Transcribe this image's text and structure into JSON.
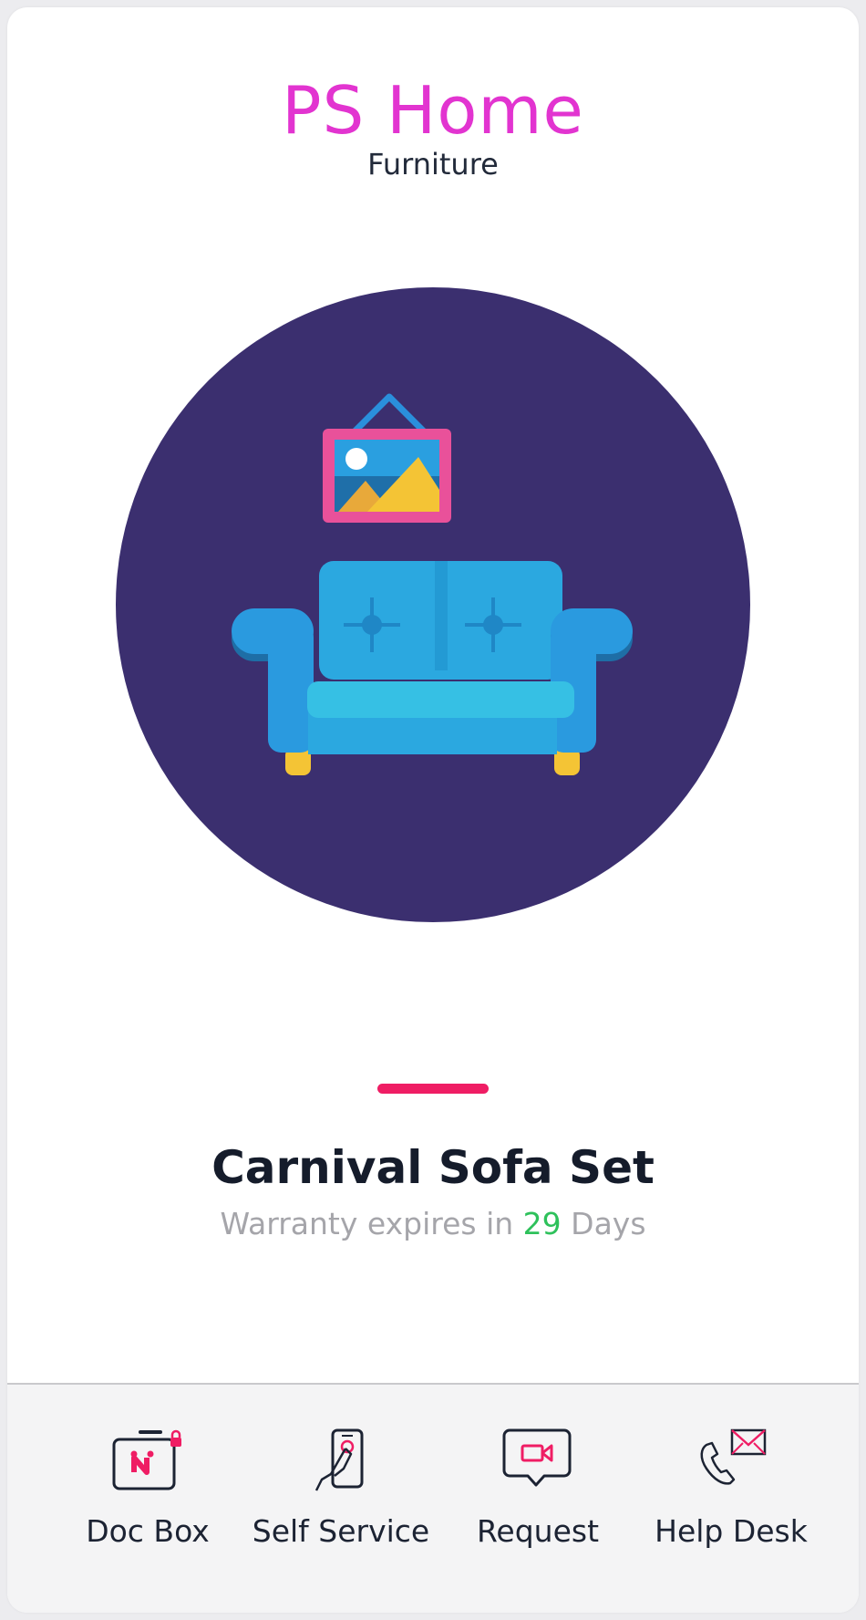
{
  "brand": {
    "title": "PS Home",
    "subtitle": "Furniture"
  },
  "hero": {
    "illustration": "sofa-with-picture-frame",
    "background_color": "#3b2f6f"
  },
  "product": {
    "name": "Carnival Sofa Set",
    "warranty_prefix": "Warranty expires in",
    "warranty_days": "29",
    "warranty_suffix": "Days"
  },
  "colors": {
    "brand": "#e234d0",
    "accent": "#ef1d64",
    "days_highlight": "#2ec15b",
    "muted_text": "#a5a5aa",
    "dark_text": "#151c2b"
  },
  "bottom_nav": {
    "items": [
      {
        "label": "Doc Box",
        "icon": "doc-box-icon"
      },
      {
        "label": "Self Service",
        "icon": "self-service-icon"
      },
      {
        "label": "Request",
        "icon": "request-video-icon"
      },
      {
        "label": "Help Desk",
        "icon": "help-desk-icon"
      }
    ]
  }
}
